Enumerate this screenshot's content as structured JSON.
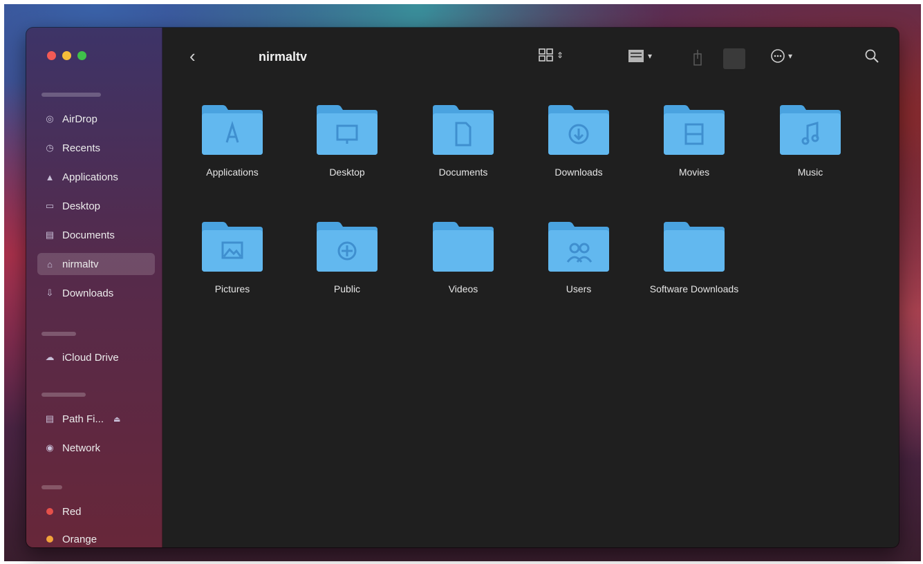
{
  "window": {
    "title": "nirmaltv"
  },
  "sidebar": {
    "items": [
      {
        "label": "AirDrop",
        "icon": "airdrop-icon"
      },
      {
        "label": "Recents",
        "icon": "clock-icon"
      },
      {
        "label": "Applications",
        "icon": "applications-icon"
      },
      {
        "label": "Desktop",
        "icon": "desktop-icon"
      },
      {
        "label": "Documents",
        "icon": "document-icon"
      },
      {
        "label": "nirmaltv",
        "icon": "home-icon",
        "selected": true
      },
      {
        "label": "Downloads",
        "icon": "downloads-icon"
      }
    ],
    "icloud_items": [
      {
        "label": "iCloud Drive",
        "icon": "cloud-icon"
      }
    ],
    "location_items": [
      {
        "label": "Path Fi...",
        "icon": "drive-icon"
      },
      {
        "label": "Network",
        "icon": "network-icon"
      }
    ],
    "tag_items": [
      {
        "label": "Red",
        "color": "#e5504a"
      },
      {
        "label": "Orange",
        "color": "#f2a33a"
      }
    ]
  },
  "toolbar": {
    "back_icon": "chevron-left-icon",
    "view_icon": "grid-view-icon",
    "group_icon": "group-icon",
    "share_icon": "share-icon",
    "tag_icon": "tag-icon",
    "action_icon": "more-icon",
    "search_icon": "search-icon"
  },
  "content": {
    "folders": [
      {
        "label": "Applications",
        "glyph": "applications"
      },
      {
        "label": "Desktop",
        "glyph": "desktop"
      },
      {
        "label": "Documents",
        "glyph": "documents"
      },
      {
        "label": "Downloads",
        "glyph": "downloads"
      },
      {
        "label": "Movies",
        "glyph": "movies"
      },
      {
        "label": "Music",
        "glyph": "music"
      },
      {
        "label": "Pictures",
        "glyph": "pictures"
      },
      {
        "label": "Public",
        "glyph": "public"
      },
      {
        "label": "Videos",
        "glyph": "none"
      },
      {
        "label": "Users",
        "glyph": "users"
      },
      {
        "label": "Software Downloads",
        "glyph": "none"
      }
    ]
  },
  "colors": {
    "folder": "#62b8ef",
    "folder_tab": "#4aa3e0",
    "glyph": "#3f8fcf"
  }
}
